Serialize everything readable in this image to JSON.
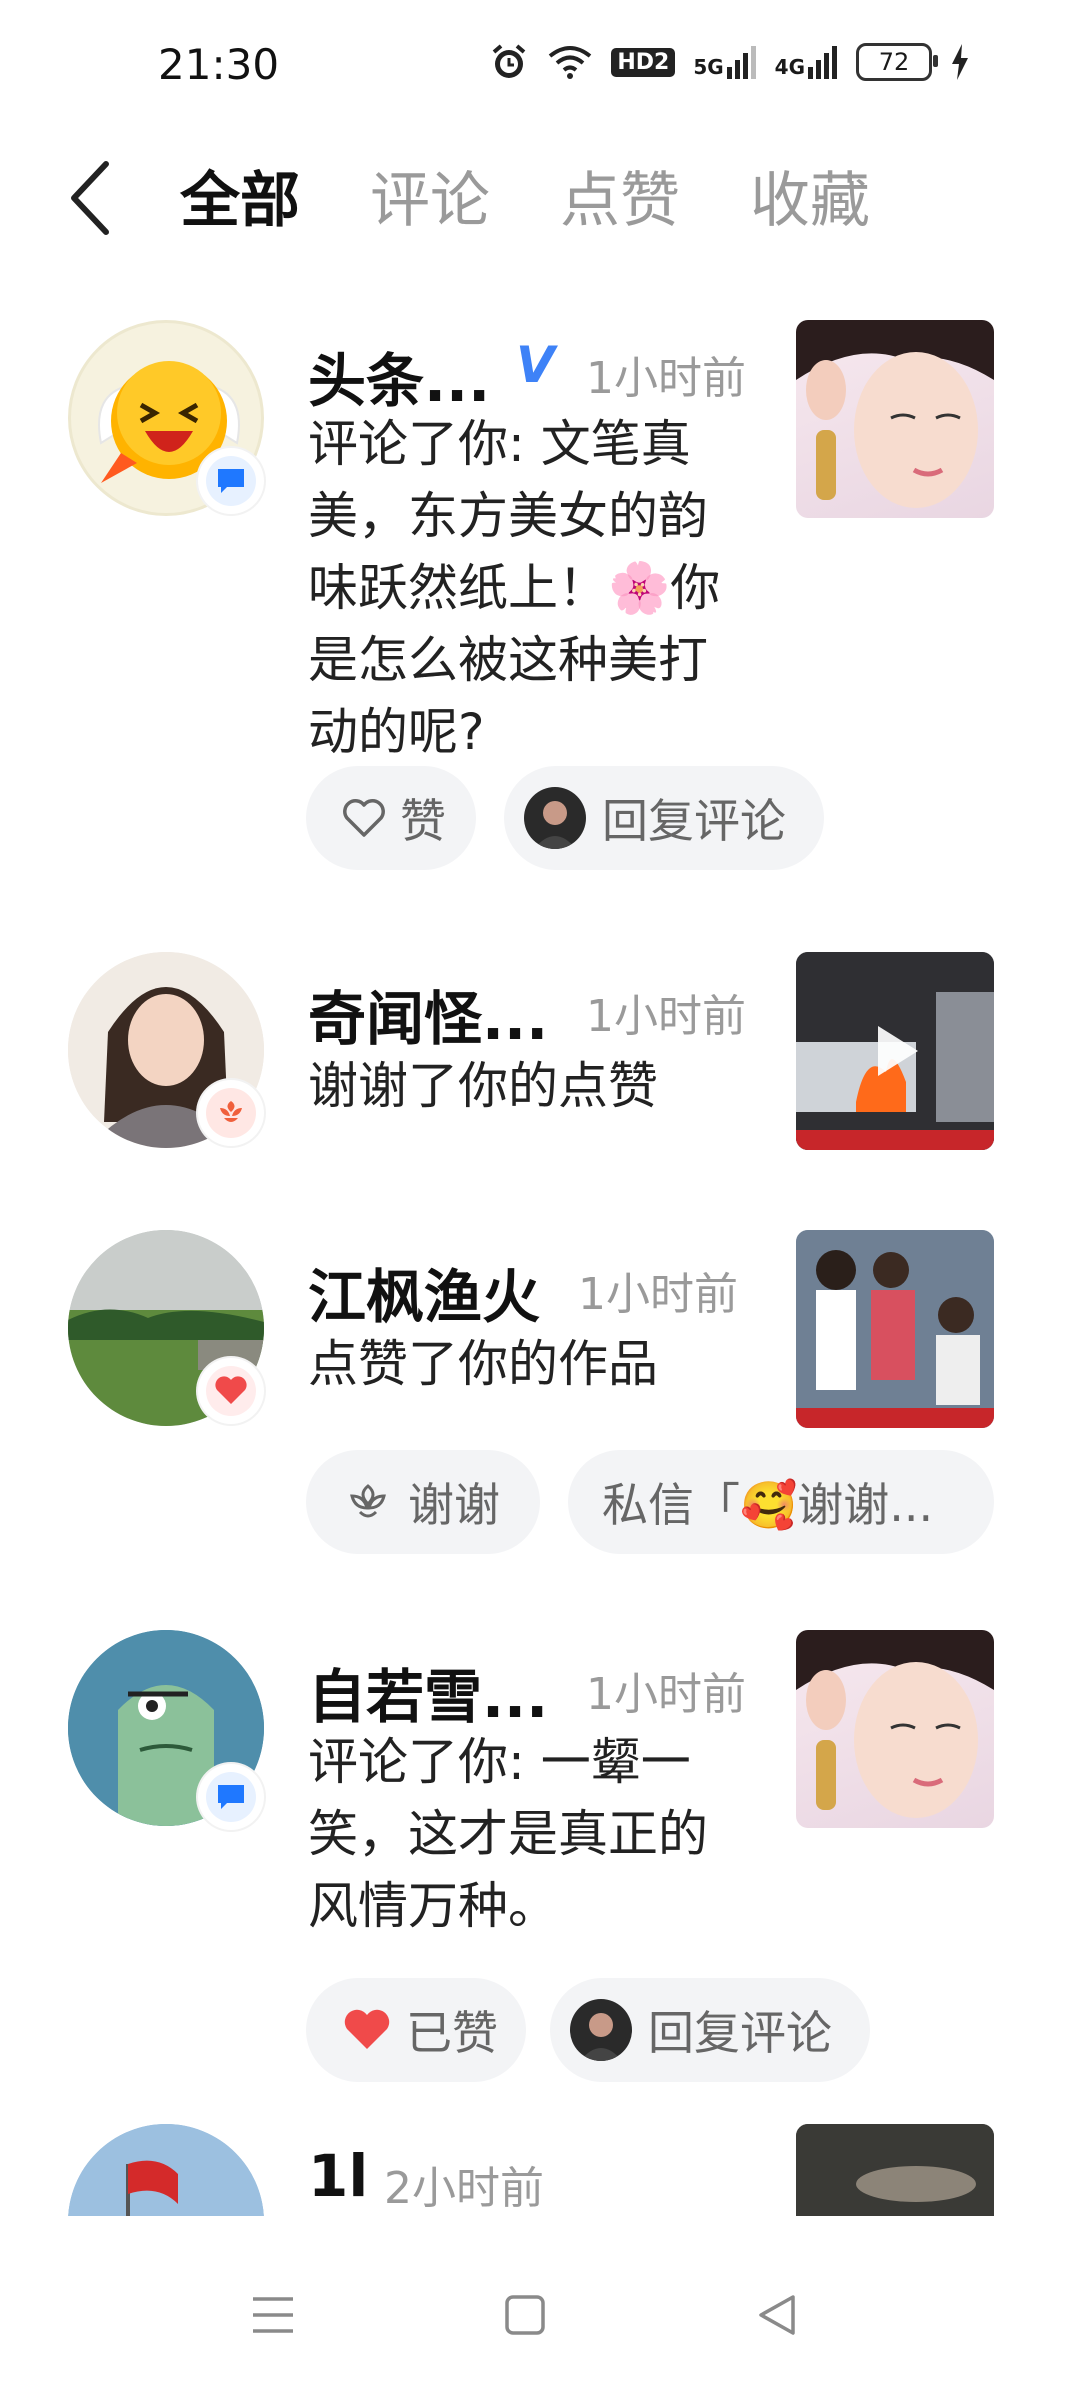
{
  "status_bar": {
    "time": "21:30",
    "network_hd": "HD2",
    "network_5g": "5G",
    "network_4g": "4G",
    "battery": "72"
  },
  "header": {
    "tabs": [
      "全部",
      "评论",
      "点赞",
      "收藏"
    ]
  },
  "notifications": [
    {
      "name": "头条...",
      "verified_mark": "V",
      "time": "1小时前",
      "lines": [
        "评论了你: 文笔真",
        "美，东方美女的韵",
        "味跃然纸上！🌸你",
        "是怎么被这种美打",
        "动的呢?"
      ],
      "actions": [
        {
          "label": "赞"
        },
        {
          "label": "回复评论"
        }
      ]
    },
    {
      "name": "奇闻怪...",
      "time": "1小时前",
      "lines": [
        "谢谢了你的点赞"
      ]
    },
    {
      "name": "江枫渔火",
      "time": "1小时前",
      "lines": [
        "点赞了你的作品"
      ],
      "actions": [
        {
          "label": "谢谢"
        },
        {
          "label": "私信「🥰谢谢..."
        }
      ]
    },
    {
      "name": "自若雪...",
      "time": "1小时前",
      "lines": [
        "评论了你: 一颦一",
        "笑，这才是真正的",
        "风情万种。"
      ],
      "actions": [
        {
          "label": "已赞"
        },
        {
          "label": "回复评论"
        }
      ]
    },
    {
      "name": "1l",
      "time": "2小时前"
    }
  ],
  "colors": {
    "accent_blue": "#3e82f7",
    "like_red": "#f04a4a",
    "muted": "#9a9a9a"
  }
}
